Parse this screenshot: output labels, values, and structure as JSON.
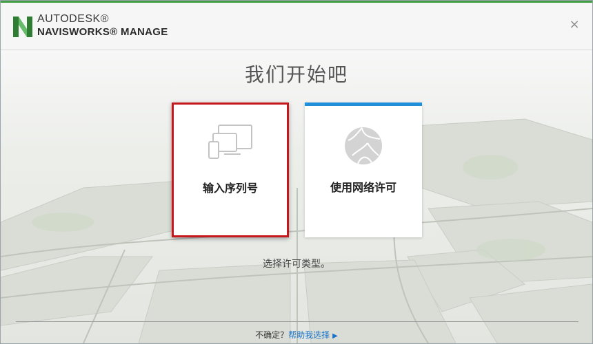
{
  "app": {
    "brand_company": "AUTODESK®",
    "brand_product": "NAVISWORKS® MANAGE",
    "close_glyph": "×",
    "accent_green": "#43a047"
  },
  "main": {
    "title": "我们开始吧",
    "subtitle": "选择许可类型。",
    "options": [
      {
        "label": "输入序列号",
        "icon": "devices-icon",
        "selected": true,
        "highlight_color": "#c8161d"
      },
      {
        "label": "使用网络许可",
        "icon": "network-globe-icon",
        "selected": false,
        "accent_color": "#1e8fd8"
      }
    ]
  },
  "footer": {
    "question": "不确定？",
    "help_link": "帮助我选择",
    "arrow_glyph": "▶"
  }
}
